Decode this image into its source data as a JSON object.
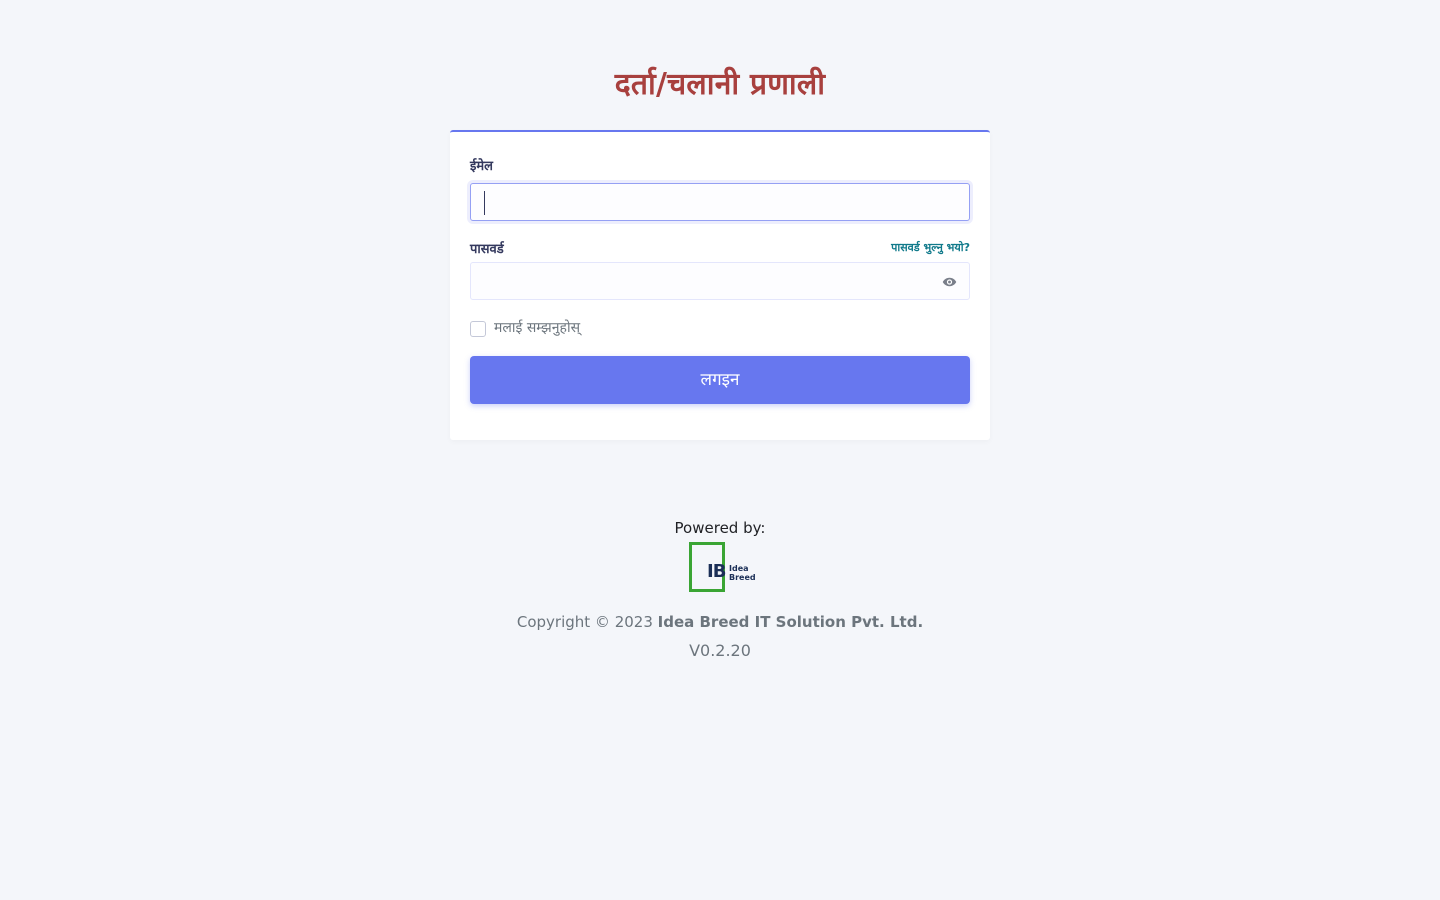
{
  "app": {
    "title": "दर्ता/चलानी प्रणाली"
  },
  "login_form": {
    "email_label": "ईमेल",
    "email_value": "",
    "password_label": "पासवर्ड",
    "password_value": "",
    "forgot_password_link": "पासवर्ड भुल्नु भयो?",
    "remember_me_label": "मलाई सम्झनुहोस्",
    "remember_me_checked": false,
    "login_button_label": "लगइन",
    "password_toggle_icon": "eye-icon"
  },
  "footer": {
    "powered_by": "Powered by:",
    "logo_initials": "IB",
    "logo_word_1": "Idea",
    "logo_word_2": "Breed",
    "copyright_prefix": "Copyright © 2023",
    "company_name": "Idea Breed IT Solution Pvt. Ltd.",
    "version": "V0.2.20"
  },
  "colors": {
    "title": "#a8403e",
    "primary": "#6777ef",
    "link": "#117a8b",
    "logo_green": "#3aa534",
    "logo_navy": "#1b2f57",
    "background": "#f4f6fa"
  }
}
